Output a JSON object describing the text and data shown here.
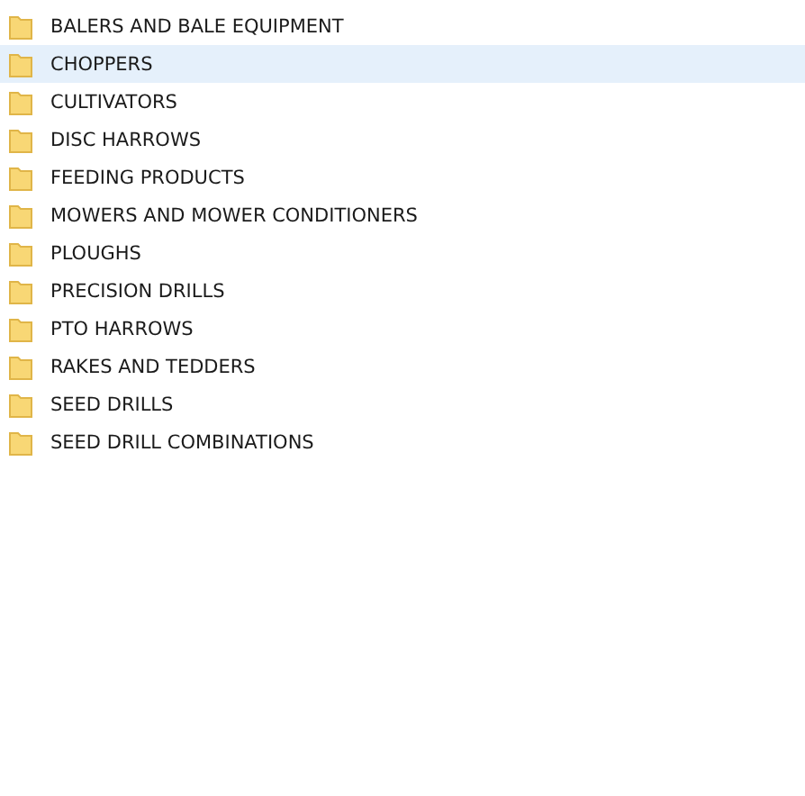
{
  "folders": [
    {
      "name": "BALERS AND BALE EQUIPMENT",
      "selected": false
    },
    {
      "name": "CHOPPERS",
      "selected": true
    },
    {
      "name": "CULTIVATORS",
      "selected": false
    },
    {
      "name": "DISC HARROWS",
      "selected": false
    },
    {
      "name": "FEEDING PRODUCTS",
      "selected": false
    },
    {
      "name": "MOWERS AND MOWER CONDITIONERS",
      "selected": false
    },
    {
      "name": "PLOUGHS",
      "selected": false
    },
    {
      "name": "PRECISION DRILLS",
      "selected": false
    },
    {
      "name": "PTO HARROWS",
      "selected": false
    },
    {
      "name": "RAKES AND TEDDERS",
      "selected": false
    },
    {
      "name": "SEED DRILLS",
      "selected": false
    },
    {
      "name": "SEED DRILL COMBINATIONS",
      "selected": false
    }
  ]
}
